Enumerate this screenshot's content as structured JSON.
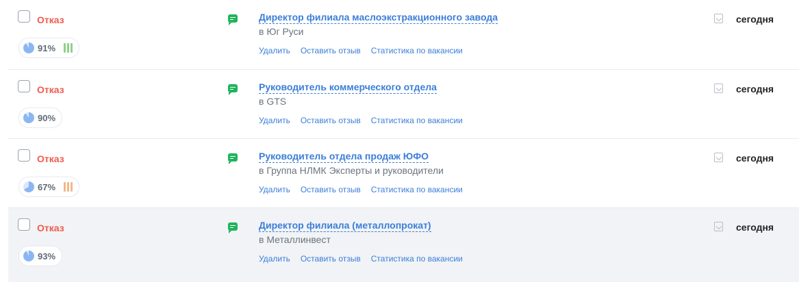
{
  "rows": [
    {
      "status": "Отказ",
      "match_percent": 91,
      "match_label": "91%",
      "indicator": "green-bars",
      "title": "Директор филиала маслоэкстракционного завода",
      "company": "в Юг Руси",
      "actions": [
        "Удалить",
        "Оставить отзыв",
        "Статистика по вакансии"
      ],
      "date": "сегодня"
    },
    {
      "status": "Отказ",
      "match_percent": 90,
      "match_label": "90%",
      "indicator": "none",
      "title": "Руководитель коммерческого отдела",
      "company": "в GTS",
      "actions": [
        "Удалить",
        "Оставить отзыв",
        "Статистика по вакансии"
      ],
      "date": "сегодня"
    },
    {
      "status": "Отказ",
      "match_percent": 67,
      "match_label": "67%",
      "indicator": "orange-bars",
      "title": "Руководитель отдела продаж ЮФО",
      "company": "в Группа НЛМК Эксперты и руководители",
      "actions": [
        "Удалить",
        "Оставить отзыв",
        "Статистика по вакансии"
      ],
      "date": "сегодня"
    },
    {
      "status": "Отказ",
      "match_percent": 93,
      "match_label": "93%",
      "indicator": "none",
      "title": "Директор филиала (металлопрокат)",
      "company": "в Металлинвест",
      "actions": [
        "Удалить",
        "Оставить отзыв",
        "Статистика по вакансии"
      ],
      "date": "сегодня"
    }
  ],
  "colors": {
    "status": "#ef5b4f",
    "link": "#3b7ed7",
    "chat": "#1fb45b",
    "pie_fill": "#8ab6f3",
    "pie_track": "#dbe8fb",
    "highlight_row": "#f1f3f6"
  },
  "icons": {
    "chat": "chat-icon",
    "match": "match-pie-icon",
    "document": "resume-file-icon"
  }
}
